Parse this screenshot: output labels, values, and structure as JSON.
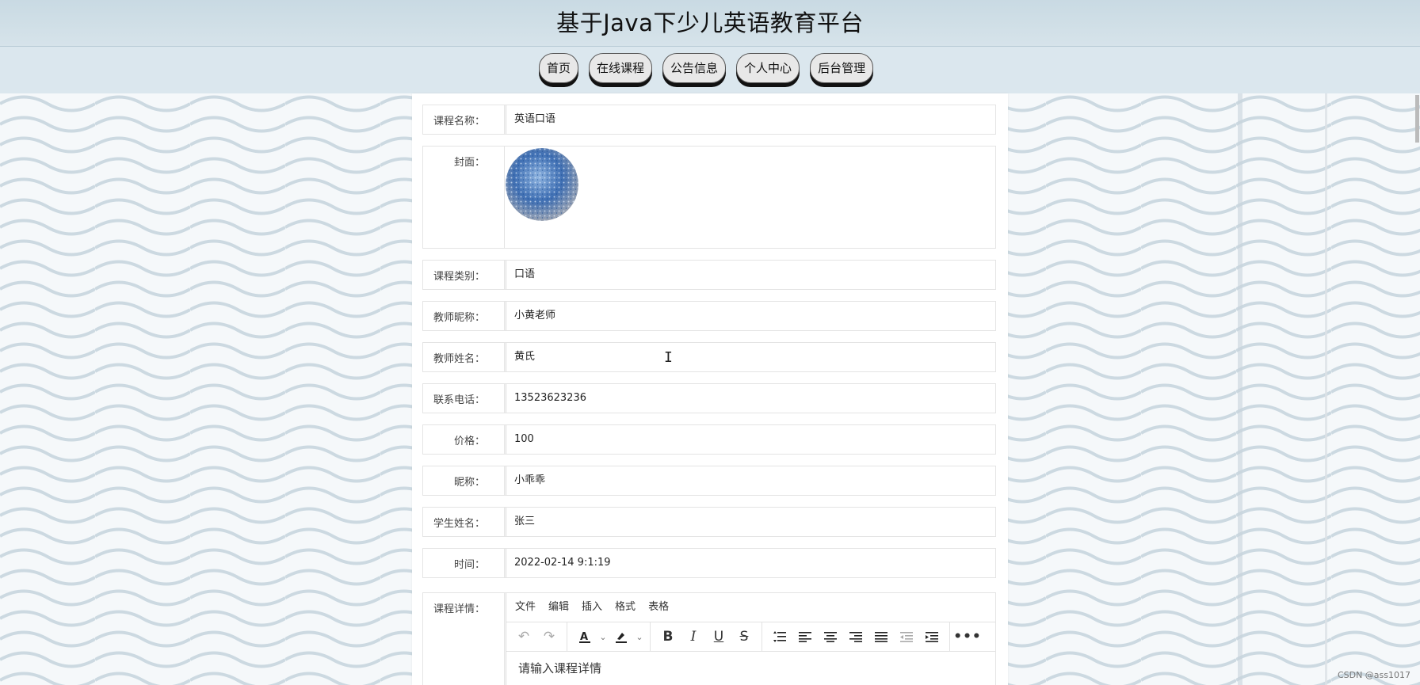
{
  "header": {
    "title": "基于Java下少儿英语教育平台"
  },
  "nav": {
    "items": [
      "首页",
      "在线课程",
      "公告信息",
      "个人中心",
      "后台管理"
    ]
  },
  "form": {
    "course_name_label": "课程名称：",
    "course_name": "英语口语",
    "cover_label": "封面：",
    "category_label": "课程类别：",
    "category": "口语",
    "teacher_nick_label": "教师昵称：",
    "teacher_nick": "小黄老师",
    "teacher_name_label": "教师姓名：",
    "teacher_name": "黄氏",
    "phone_label": "联系电话：",
    "phone": "13523623236",
    "price_label": "价格：",
    "price": "100",
    "nickname_label": "昵称：",
    "nickname": "小乖乖",
    "student_name_label": "学生姓名：",
    "student_name": "张三",
    "time_label": "时间：",
    "time": "2022-02-14 9:1:19",
    "details_label": "课程详情："
  },
  "editor": {
    "menus": [
      "文件",
      "编辑",
      "插入",
      "格式",
      "表格"
    ],
    "placeholder": "请输入课程详情"
  },
  "watermark": "CSDN @ass1017"
}
